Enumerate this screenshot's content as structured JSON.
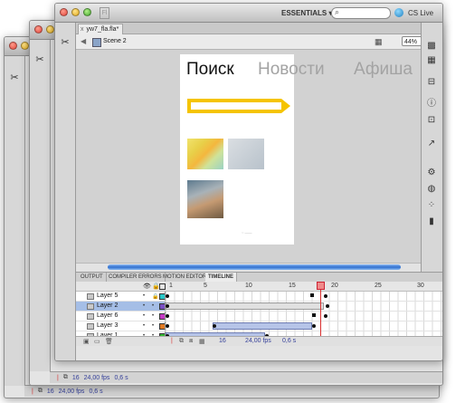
{
  "window": {
    "tab_title": "yw7_fla.fla*",
    "tab_close": "x",
    "doc_icon": "Fl",
    "workspace": "ESSENTIALS ▾",
    "search_placeholder": "",
    "cs_live": "CS Live"
  },
  "editbar": {
    "scene": "Scene 2",
    "zoom": "44%"
  },
  "stage": {
    "nav_active": "Поиск",
    "nav_items": [
      "Новости",
      "Афиша"
    ],
    "accent_yellow": "#f5c400"
  },
  "panel_tabs": [
    "OUTPUT",
    "COMPILER ERRORS",
    "MOTION EDITOR",
    "TIMELINE"
  ],
  "timeline": {
    "ruler": [
      "1",
      "5",
      "10",
      "15",
      "20",
      "25",
      "30"
    ],
    "layers": [
      {
        "name": "Layer 5",
        "color": "#28c8c8"
      },
      {
        "name": "Layer 2",
        "color": "#7a4fc4"
      },
      {
        "name": "Layer 6",
        "color": "#c43ac4"
      },
      {
        "name": "Layer 3",
        "color": "#e07a22"
      },
      {
        "name": "Layer 1",
        "color": "#33b833"
      }
    ],
    "status": {
      "frame": "16",
      "fps": "24,00 fps",
      "time": "0,6 s"
    }
  },
  "back_windows": [
    {
      "frame": "16",
      "fps": "24,00 fps",
      "time": "0,6 s"
    },
    {
      "frame": "16",
      "fps": "24,00 fps",
      "time": "0,6 s"
    }
  ]
}
